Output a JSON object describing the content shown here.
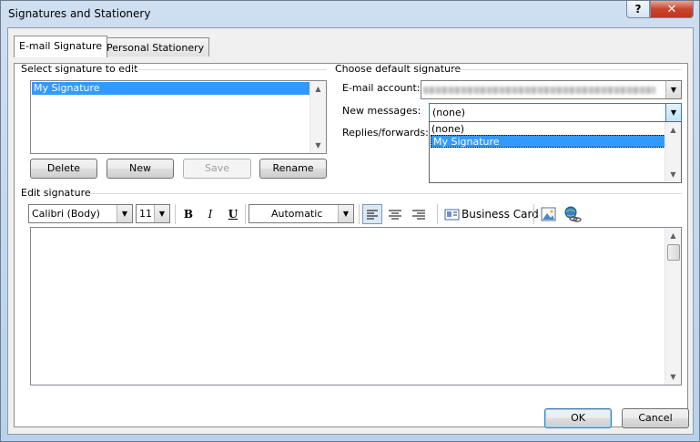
{
  "window": {
    "title": "Signatures and Stationery",
    "help_glyph": "?",
    "close_glyph": "✕"
  },
  "tabs": [
    {
      "label": "E-mail Signature",
      "active": true
    },
    {
      "label": "Personal Stationery",
      "active": false
    }
  ],
  "select_signature": {
    "group_label": "Select signature to edit",
    "items": [
      "My Signature"
    ],
    "selected": "My Signature"
  },
  "sig_buttons": {
    "delete": "Delete",
    "new": "New",
    "save": "Save",
    "rename": "Rename"
  },
  "default_signature": {
    "group_label": "Choose default signature",
    "email_account_label": "E-mail account:",
    "email_account_value": "",
    "new_messages_label": "New messages:",
    "new_messages_value": "(none)",
    "replies_label": "Replies/forwards:",
    "dropdown_options": [
      "(none)",
      "My Signature"
    ],
    "dropdown_highlighted": "My Signature"
  },
  "edit_signature": {
    "group_label": "Edit signature",
    "font": "Calibri (Body)",
    "size": "11",
    "bold": "B",
    "italic": "I",
    "underline": "U",
    "color": "Automatic",
    "business_card": "Business Card"
  },
  "footer": {
    "ok": "OK",
    "cancel": "Cancel"
  },
  "colors": {
    "selection": "#3399ff",
    "title_gradient_top": "#cfdff1",
    "close_red": "#c8452d"
  }
}
